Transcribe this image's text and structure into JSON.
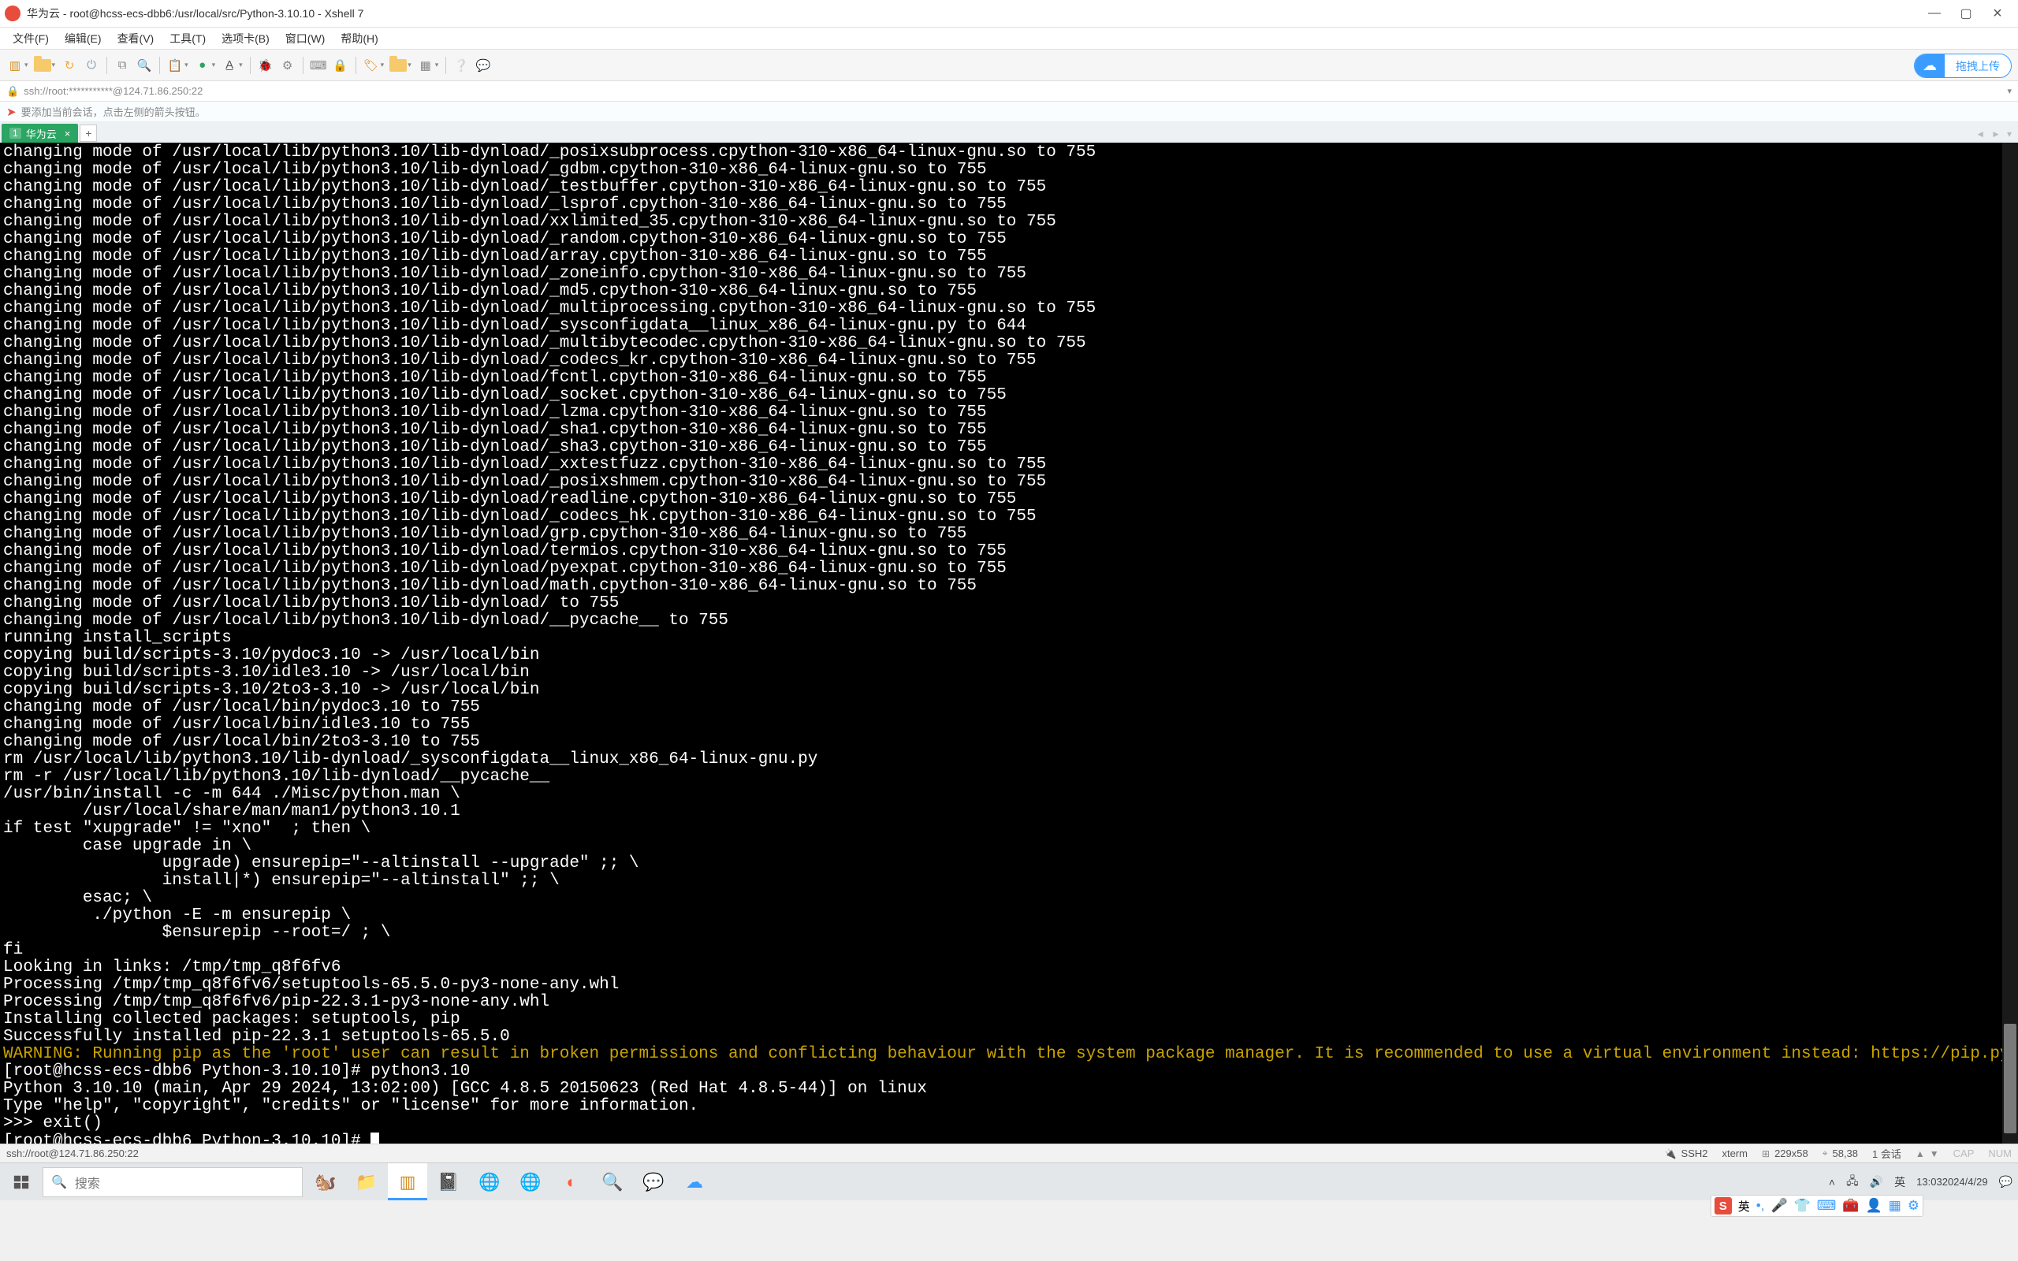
{
  "window": {
    "title": "华为云 - root@hcss-ecs-dbb6:/usr/local/src/Python-3.10.10 - Xshell 7"
  },
  "menubar": {
    "items": [
      "文件(F)",
      "编辑(E)",
      "查看(V)",
      "工具(T)",
      "选项卡(B)",
      "窗口(W)",
      "帮助(H)"
    ]
  },
  "upload": {
    "label": "拖拽上传"
  },
  "addr": {
    "text": "ssh://root:***********@124.71.86.250:22"
  },
  "hint": {
    "text": "要添加当前会话，点击左侧的箭头按钮。"
  },
  "tab": {
    "index": "1",
    "label": "华为云"
  },
  "terminal": {
    "lines": [
      "changing mode of /usr/local/lib/python3.10/lib-dynload/_posixsubprocess.cpython-310-x86_64-linux-gnu.so to 755",
      "changing mode of /usr/local/lib/python3.10/lib-dynload/_gdbm.cpython-310-x86_64-linux-gnu.so to 755",
      "changing mode of /usr/local/lib/python3.10/lib-dynload/_testbuffer.cpython-310-x86_64-linux-gnu.so to 755",
      "changing mode of /usr/local/lib/python3.10/lib-dynload/_lsprof.cpython-310-x86_64-linux-gnu.so to 755",
      "changing mode of /usr/local/lib/python3.10/lib-dynload/xxlimited_35.cpython-310-x86_64-linux-gnu.so to 755",
      "changing mode of /usr/local/lib/python3.10/lib-dynload/_random.cpython-310-x86_64-linux-gnu.so to 755",
      "changing mode of /usr/local/lib/python3.10/lib-dynload/array.cpython-310-x86_64-linux-gnu.so to 755",
      "changing mode of /usr/local/lib/python3.10/lib-dynload/_zoneinfo.cpython-310-x86_64-linux-gnu.so to 755",
      "changing mode of /usr/local/lib/python3.10/lib-dynload/_md5.cpython-310-x86_64-linux-gnu.so to 755",
      "changing mode of /usr/local/lib/python3.10/lib-dynload/_multiprocessing.cpython-310-x86_64-linux-gnu.so to 755",
      "changing mode of /usr/local/lib/python3.10/lib-dynload/_sysconfigdata__linux_x86_64-linux-gnu.py to 644",
      "changing mode of /usr/local/lib/python3.10/lib-dynload/_multibytecodec.cpython-310-x86_64-linux-gnu.so to 755",
      "changing mode of /usr/local/lib/python3.10/lib-dynload/_codecs_kr.cpython-310-x86_64-linux-gnu.so to 755",
      "changing mode of /usr/local/lib/python3.10/lib-dynload/fcntl.cpython-310-x86_64-linux-gnu.so to 755",
      "changing mode of /usr/local/lib/python3.10/lib-dynload/_socket.cpython-310-x86_64-linux-gnu.so to 755",
      "changing mode of /usr/local/lib/python3.10/lib-dynload/_lzma.cpython-310-x86_64-linux-gnu.so to 755",
      "changing mode of /usr/local/lib/python3.10/lib-dynload/_sha1.cpython-310-x86_64-linux-gnu.so to 755",
      "changing mode of /usr/local/lib/python3.10/lib-dynload/_sha3.cpython-310-x86_64-linux-gnu.so to 755",
      "changing mode of /usr/local/lib/python3.10/lib-dynload/_xxtestfuzz.cpython-310-x86_64-linux-gnu.so to 755",
      "changing mode of /usr/local/lib/python3.10/lib-dynload/_posixshmem.cpython-310-x86_64-linux-gnu.so to 755",
      "changing mode of /usr/local/lib/python3.10/lib-dynload/readline.cpython-310-x86_64-linux-gnu.so to 755",
      "changing mode of /usr/local/lib/python3.10/lib-dynload/_codecs_hk.cpython-310-x86_64-linux-gnu.so to 755",
      "changing mode of /usr/local/lib/python3.10/lib-dynload/grp.cpython-310-x86_64-linux-gnu.so to 755",
      "changing mode of /usr/local/lib/python3.10/lib-dynload/termios.cpython-310-x86_64-linux-gnu.so to 755",
      "changing mode of /usr/local/lib/python3.10/lib-dynload/pyexpat.cpython-310-x86_64-linux-gnu.so to 755",
      "changing mode of /usr/local/lib/python3.10/lib-dynload/math.cpython-310-x86_64-linux-gnu.so to 755",
      "changing mode of /usr/local/lib/python3.10/lib-dynload/ to 755",
      "changing mode of /usr/local/lib/python3.10/lib-dynload/__pycache__ to 755",
      "running install_scripts",
      "copying build/scripts-3.10/pydoc3.10 -> /usr/local/bin",
      "copying build/scripts-3.10/idle3.10 -> /usr/local/bin",
      "copying build/scripts-3.10/2to3-3.10 -> /usr/local/bin",
      "changing mode of /usr/local/bin/pydoc3.10 to 755",
      "changing mode of /usr/local/bin/idle3.10 to 755",
      "changing mode of /usr/local/bin/2to3-3.10 to 755",
      "rm /usr/local/lib/python3.10/lib-dynload/_sysconfigdata__linux_x86_64-linux-gnu.py",
      "rm -r /usr/local/lib/python3.10/lib-dynload/__pycache__",
      "/usr/bin/install -c -m 644 ./Misc/python.man \\",
      "        /usr/local/share/man/man1/python3.10.1",
      "if test \"xupgrade\" != \"xno\"  ; then \\",
      "        case upgrade in \\",
      "                upgrade) ensurepip=\"--altinstall --upgrade\" ;; \\",
      "                install|*) ensurepip=\"--altinstall\" ;; \\",
      "        esac; \\",
      "         ./python -E -m ensurepip \\",
      "                $ensurepip --root=/ ; \\",
      "fi",
      "Looking in links: /tmp/tmp_q8f6fv6",
      "Processing /tmp/tmp_q8f6fv6/setuptools-65.5.0-py3-none-any.whl",
      "Processing /tmp/tmp_q8f6fv6/pip-22.3.1-py3-none-any.whl",
      "Installing collected packages: setuptools, pip",
      "Successfully installed pip-22.3.1 setuptools-65.5.0"
    ],
    "warn": "WARNING: Running pip as the 'root' user can result in broken permissions and conflicting behaviour with the system package manager. It is recommended to use a virtual environment instead: https://pip.pypa.io/warnings/venv",
    "after": [
      "[root@hcss-ecs-dbb6 Python-3.10.10]# python3.10",
      "Python 3.10.10 (main, Apr 29 2024, 13:02:00) [GCC 4.8.5 20150623 (Red Hat 4.8.5-44)] on linux",
      "Type \"help\", \"copyright\", \"credits\" or \"license\" for more information.",
      ">>> exit()",
      "[root@hcss-ecs-dbb6 Python-3.10.10]# "
    ]
  },
  "status": {
    "left": "ssh://root@124.71.86.250:22",
    "proto": "SSH2",
    "term": "xterm",
    "size": "229x58",
    "pos": "58,38",
    "sess": "1 会话",
    "cap": "CAP",
    "num": "NUM"
  },
  "taskbar": {
    "search_placeholder": "搜索",
    "ime": "英",
    "clock_time": "13:03",
    "clock_date": "2024/4/29"
  },
  "ime_strip": {
    "lang": "英"
  }
}
